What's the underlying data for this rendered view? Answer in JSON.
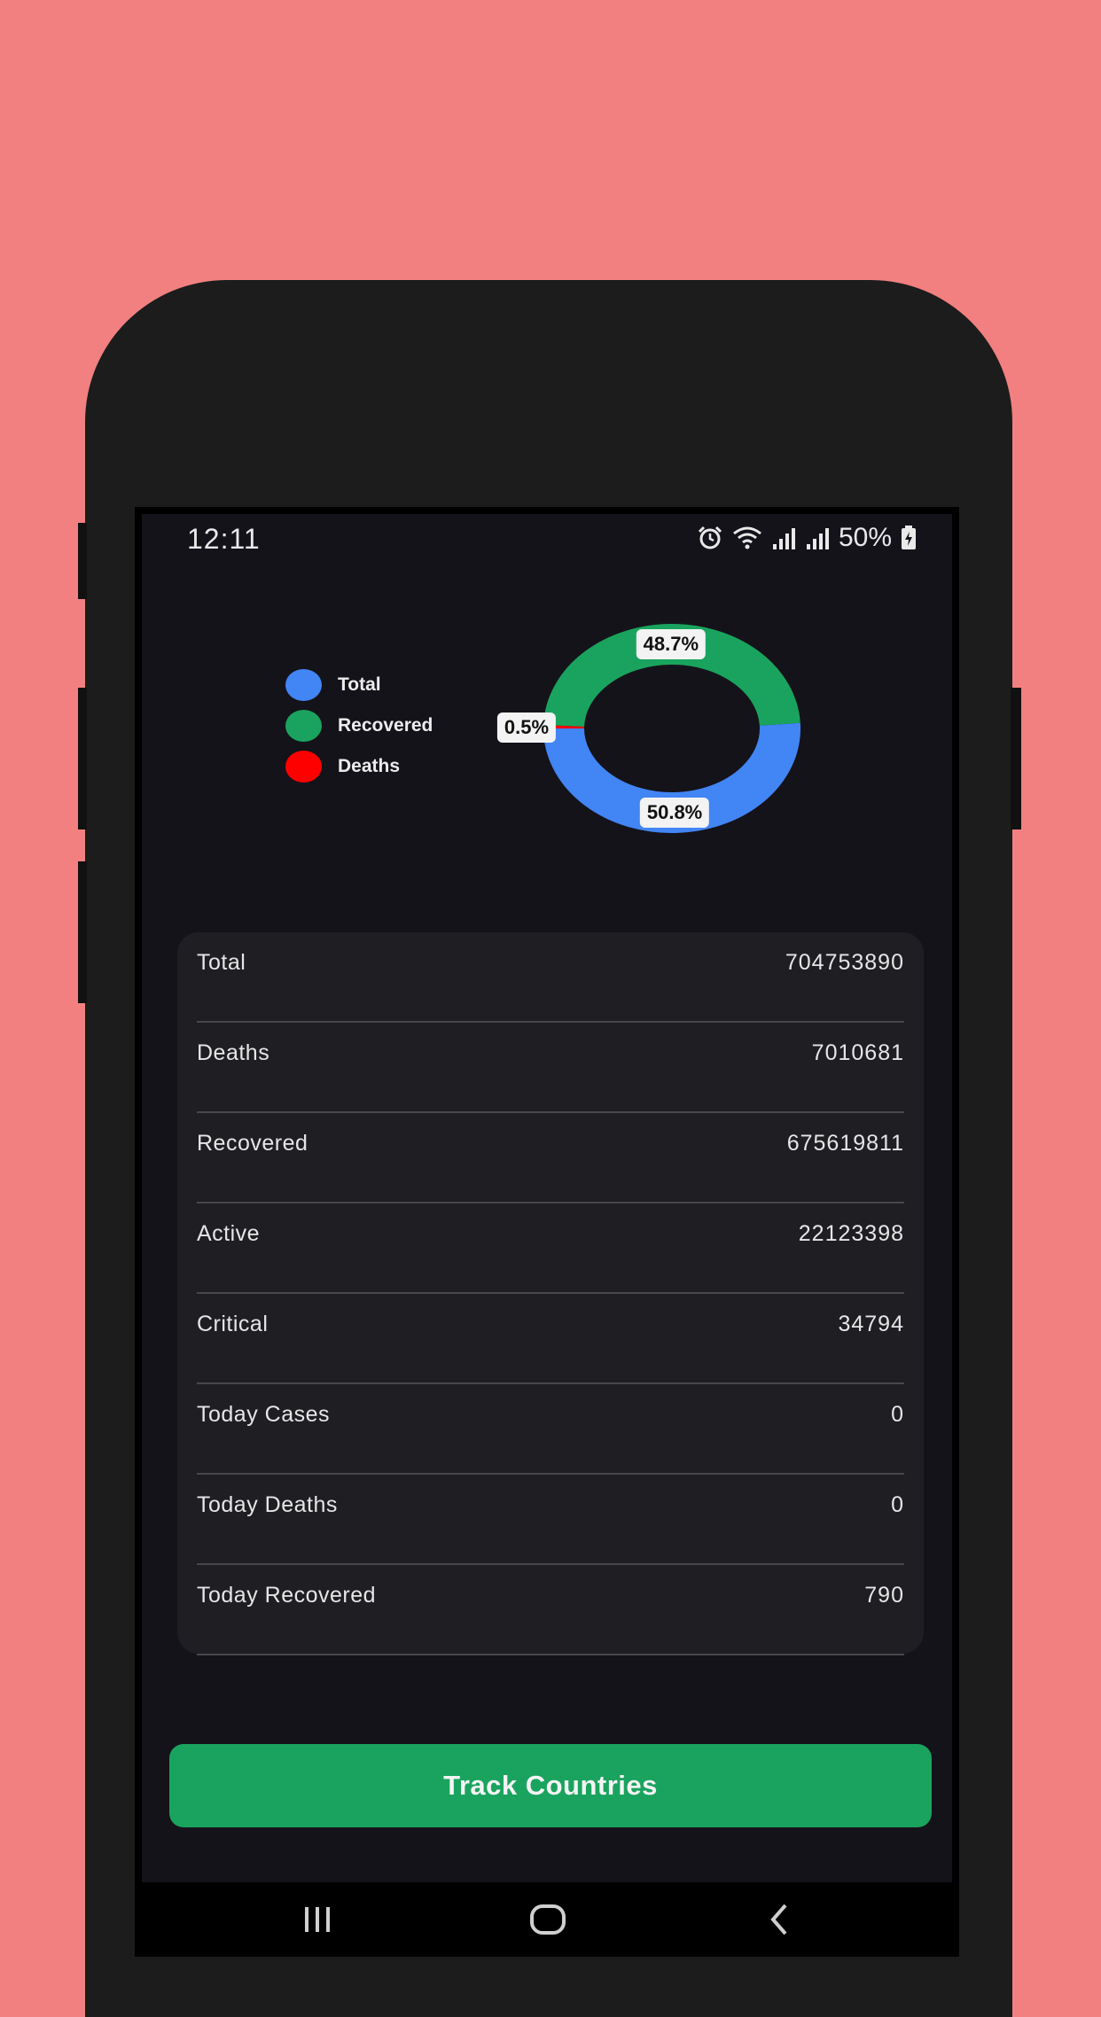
{
  "status_bar": {
    "time": "12:11",
    "battery": "50%",
    "icons": [
      "alarm-icon",
      "wifi-icon",
      "signal-icon",
      "signal-icon",
      "battery-charging-icon"
    ]
  },
  "chart_data": {
    "type": "pie",
    "categories": [
      "Total",
      "Recovered",
      "Deaths"
    ],
    "values": [
      50.8,
      48.7,
      0.5
    ],
    "labels": [
      "50.8%",
      "48.7%",
      "0.5%"
    ],
    "colors": [
      "#4285f4",
      "#1aa35e",
      "#ff0000"
    ],
    "legend_position": "left"
  },
  "stats": [
    {
      "label": "Total",
      "value": "704753890"
    },
    {
      "label": "Deaths",
      "value": "7010681"
    },
    {
      "label": "Recovered",
      "value": "675619811"
    },
    {
      "label": "Active",
      "value": "22123398"
    },
    {
      "label": "Critical",
      "value": "34794"
    },
    {
      "label": "Today Cases",
      "value": "0"
    },
    {
      "label": "Today Deaths",
      "value": "0"
    },
    {
      "label": "Today Recovered",
      "value": "790"
    }
  ],
  "track_button_label": "Track Countries",
  "nav_icons": [
    "recent-apps-icon",
    "home-icon",
    "back-icon"
  ],
  "colors": {
    "background": "#f28080",
    "screen": "#14131a",
    "card": "#1f1e23",
    "accent": "#1aa35e"
  }
}
